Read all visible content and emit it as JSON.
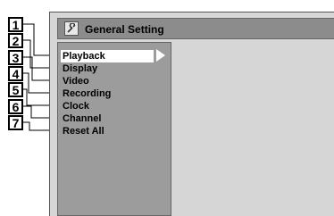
{
  "window": {
    "title": "General Setting",
    "title_icon": "wrench-icon"
  },
  "menu": {
    "items": [
      {
        "number": "1",
        "label": "Playback",
        "selected": true
      },
      {
        "number": "2",
        "label": "Display",
        "selected": false
      },
      {
        "number": "3",
        "label": "Video",
        "selected": false
      },
      {
        "number": "4",
        "label": "Recording",
        "selected": false
      },
      {
        "number": "5",
        "label": "Clock",
        "selected": false
      },
      {
        "number": "6",
        "label": "Channel",
        "selected": false
      },
      {
        "number": "7",
        "label": "Reset All",
        "selected": false
      }
    ]
  }
}
